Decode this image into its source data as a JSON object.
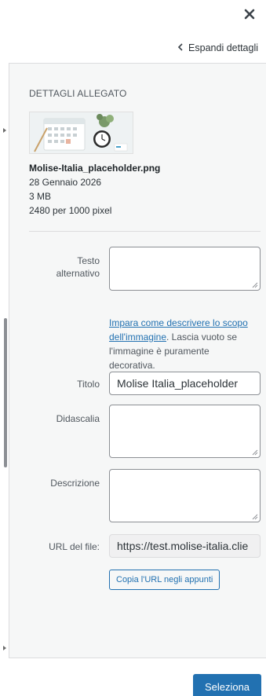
{
  "header": {
    "close_icon": "close-icon",
    "expand_label": "Espandi dettagli",
    "expand_icon": "chevron-left-icon"
  },
  "details": {
    "title": "DETTAGLI ALLEGATO",
    "file_name": "Molise-Italia_placeholder.png",
    "date": "28 Gennaio 2026",
    "size": "3 MB",
    "dimensions": "2480 per 1000 pixel"
  },
  "form": {
    "alt_text": {
      "label_line1": "Testo",
      "label_line2": "alternativo",
      "value": ""
    },
    "help": {
      "link_text": "Impara come descrivere lo scopo dell'immagine",
      "rest_text": ". Lascia vuoto se l'immagine è puramente decorativa."
    },
    "title": {
      "label": "Titolo",
      "value": "Molise Italia_placeholder"
    },
    "caption": {
      "label": "Didascalia",
      "value": ""
    },
    "description": {
      "label": "Descrizione",
      "value": ""
    },
    "file_url": {
      "label": "URL del file:",
      "value": "https://test.molise-italia.clie"
    },
    "copy_button": "Copia l'URL negli appunti"
  },
  "footer": {
    "select_button": "Seleziona"
  },
  "colors": {
    "accent": "#2271b1",
    "panel_bg": "#f6f7f7",
    "border": "#8c8f94"
  }
}
